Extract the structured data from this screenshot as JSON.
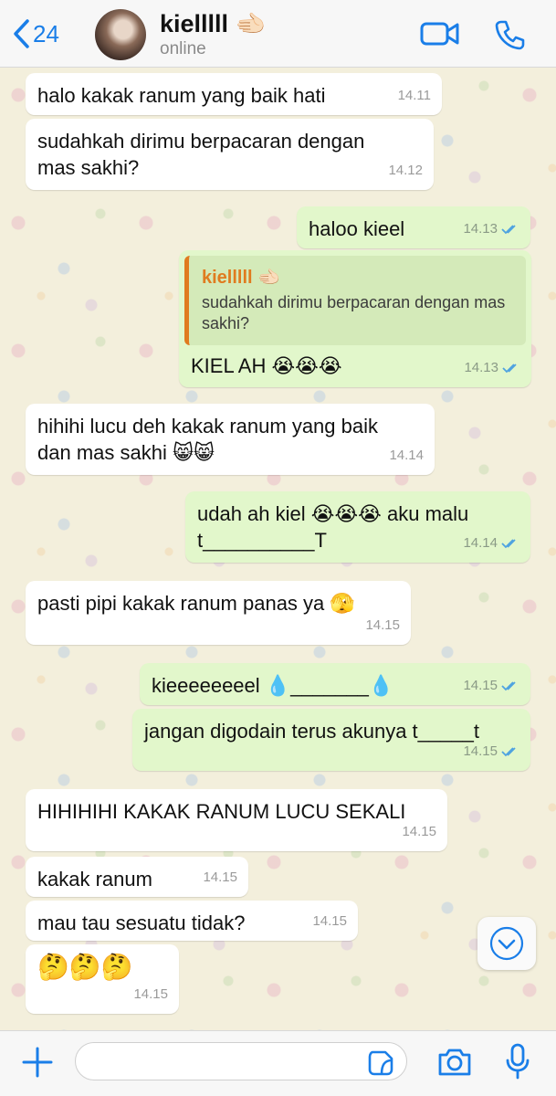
{
  "header": {
    "back_count": "24",
    "contact_name": "kielllll 🫲🏻",
    "status": "online"
  },
  "colors": {
    "accent": "#1a7ee8",
    "outgoing_bubble": "#e2f7cb",
    "incoming_bubble": "#ffffff",
    "quote_name": "#e07b1f",
    "read_ticks": "#4fa3e0"
  },
  "messages": [
    {
      "dir": "in",
      "lines": [
        "halo kakak ranum yang baik hati"
      ],
      "time": "14.11"
    },
    {
      "dir": "in",
      "lines": [
        "sudahkah dirimu berpacaran dengan",
        "mas sakhi?"
      ],
      "time": "14.12"
    },
    {
      "dir": "out",
      "lines": [
        "haloo kieel"
      ],
      "time": "14.13",
      "read": true
    },
    {
      "dir": "out",
      "reply_to": {
        "name": "kielllll 🫲🏻",
        "text": "sudahkah dirimu berpacaran dengan mas sakhi?"
      },
      "lines": [
        "KIEL AH 😭😭😭"
      ],
      "time": "14.13",
      "read": true
    },
    {
      "dir": "in",
      "lines": [
        "hihihi lucu deh kakak ranum yang baik",
        "dan mas sakhi 😸😸"
      ],
      "time": "14.14"
    },
    {
      "dir": "out",
      "lines": [
        "udah ah kiel 😭😭😭 aku malu",
        "t__________T"
      ],
      "time": "14.14",
      "read": true
    },
    {
      "dir": "in",
      "lines": [
        "pasti pipi kakak ranum panas ya 🫣"
      ],
      "time": "14.15"
    },
    {
      "dir": "out",
      "lines": [
        "kieeeeeeeel 💧_______💧"
      ],
      "time": "14.15",
      "read": true
    },
    {
      "dir": "out",
      "lines": [
        "jangan digodain terus akunya t_____t"
      ],
      "time": "14.15",
      "read": true
    },
    {
      "dir": "in",
      "lines": [
        "HIHIHIHI KAKAK RANUM LUCU SEKALI"
      ],
      "time": "14.15"
    },
    {
      "dir": "in",
      "lines": [
        "kakak ranum"
      ],
      "time": "14.15"
    },
    {
      "dir": "in",
      "lines": [
        "mau tau sesuatu tidak?"
      ],
      "time": "14.15"
    },
    {
      "dir": "in",
      "lines": [
        "🤔🤔🤔"
      ],
      "time": "14.15"
    }
  ],
  "input": {
    "placeholder": ""
  },
  "icons": [
    "back-chevron-icon",
    "video-call-icon",
    "phone-icon",
    "scroll-down-icon",
    "plus-icon",
    "sticker-icon",
    "camera-icon",
    "microphone-icon"
  ]
}
